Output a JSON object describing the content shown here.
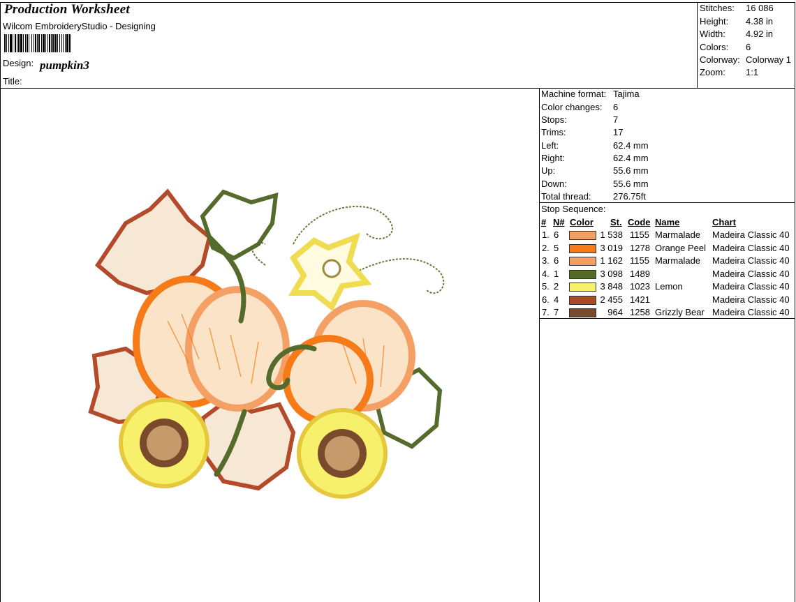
{
  "header": {
    "title": "Production Worksheet",
    "subtitle": "Wilcom EmbroideryStudio - Designing",
    "design_label": "Design:",
    "design_name": "pumpkin3",
    "title_label": "Title:"
  },
  "summary": [
    {
      "label": "Stitches:",
      "value": "16 086"
    },
    {
      "label": "Height:",
      "value": "4.38 in"
    },
    {
      "label": "Width:",
      "value": "4.92 in"
    },
    {
      "label": "Colors:",
      "value": "6"
    },
    {
      "label": "Colorway:",
      "value": "Colorway 1"
    },
    {
      "label": "Zoom:",
      "value": "1:1"
    }
  ],
  "machine": [
    {
      "label": "Machine format:",
      "value": "Tajima"
    },
    {
      "label": "Color changes:",
      "value": "6"
    },
    {
      "label": "Stops:",
      "value": "7"
    },
    {
      "label": "Trims:",
      "value": "17"
    },
    {
      "label": "Left:",
      "value": "62.4 mm"
    },
    {
      "label": "Right:",
      "value": "62.4 mm"
    },
    {
      "label": "Up:",
      "value": "55.6 mm"
    },
    {
      "label": "Down:",
      "value": "55.6 mm"
    },
    {
      "label": "Total thread:",
      "value": "276.75ft"
    }
  ],
  "stop_sequence": {
    "label": "Stop Sequence:",
    "headers": {
      "num": "#",
      "n": "N#",
      "color": "Color",
      "st": "St.",
      "code": "Code",
      "name": "Name",
      "chart": "Chart"
    },
    "rows": [
      {
        "num": "1.",
        "n": "6",
        "color": "#F4A064",
        "st": "1 538",
        "code": "1155",
        "name": "Marmalade",
        "chart": "Madeira Classic 40"
      },
      {
        "num": "2.",
        "n": "5",
        "color": "#F77A18",
        "st": "3 019",
        "code": "1278",
        "name": "Orange Peel",
        "chart": "Madeira Classic 40"
      },
      {
        "num": "3.",
        "n": "6",
        "color": "#F4A064",
        "st": "1 162",
        "code": "1155",
        "name": "Marmalade",
        "chart": "Madeira Classic 40"
      },
      {
        "num": "4.",
        "n": "1",
        "color": "#556B2C",
        "st": "3 098",
        "code": "1489",
        "name": "",
        "chart": "Madeira Classic 40"
      },
      {
        "num": "5.",
        "n": "2",
        "color": "#F6F06A",
        "st": "3 848",
        "code": "1023",
        "name": "Lemon",
        "chart": "Madeira Classic 40"
      },
      {
        "num": "6.",
        "n": "4",
        "color": "#A84A24",
        "st": "2 455",
        "code": "1421",
        "name": "",
        "chart": "Madeira Classic 40"
      },
      {
        "num": "7.",
        "n": "7",
        "color": "#7A4A2C",
        "st": "964",
        "code": "1258",
        "name": "Grizzly Bear",
        "chart": "Madeira Classic 40"
      }
    ]
  }
}
